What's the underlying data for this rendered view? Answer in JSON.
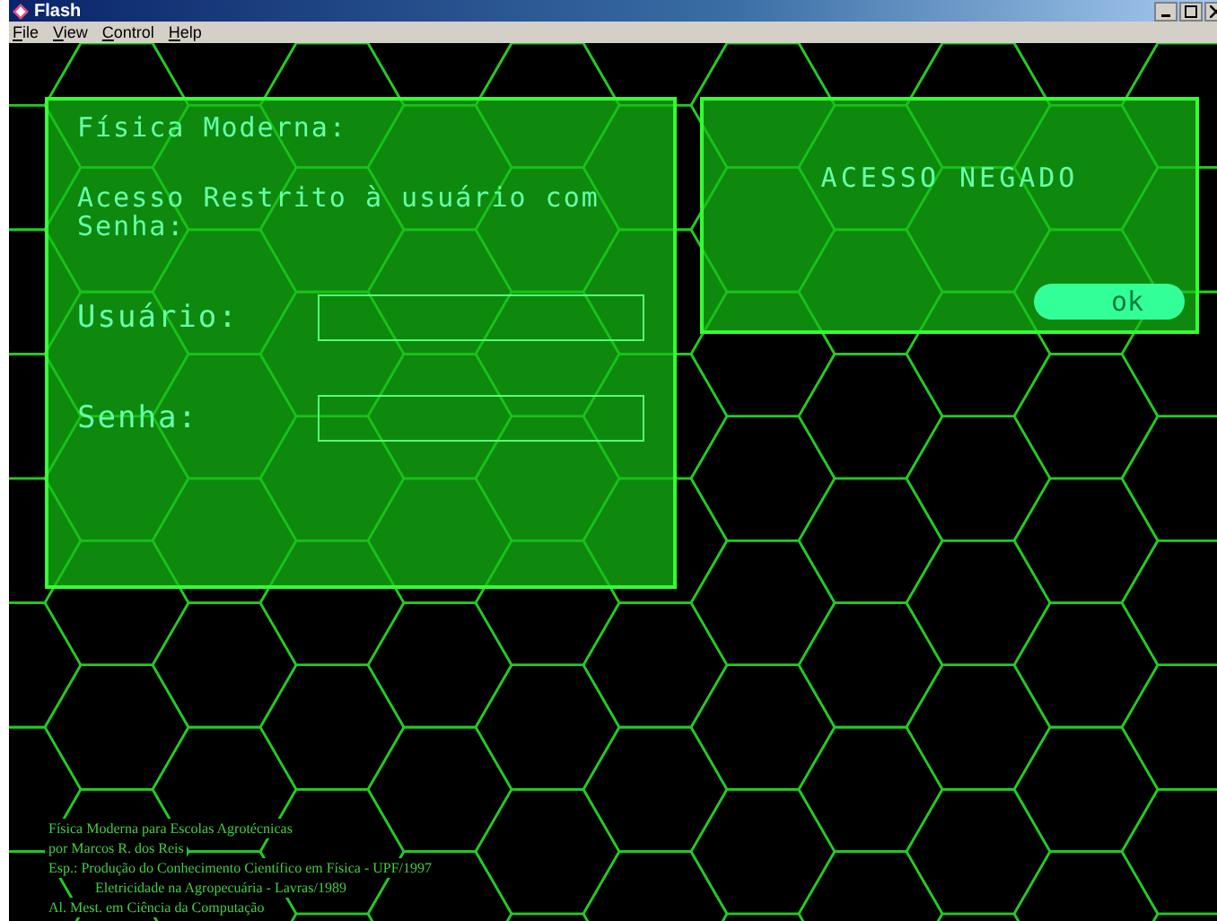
{
  "window": {
    "title": "Flash"
  },
  "menu": [
    "File",
    "View",
    "Control",
    "Help"
  ],
  "login_panel": {
    "title": "Física Moderna:",
    "message": "Acesso Restrito à usuário com Senha:",
    "fields": [
      {
        "label": "Usuário:"
      },
      {
        "label": "Senha:"
      }
    ]
  },
  "alert_panel": {
    "message": "ACESSO NEGADO",
    "button": "ok"
  },
  "credits": [
    "Física Moderna para Escolas Agrotécnicas",
    "por Marcos R. dos Reis",
    "Esp.: Produção do Conhecimento Científico em Física - UPF/1997",
    "Eletricidade na Agropecuária - Lavras/1989",
    "Al. Mest. em Ciência da Computação"
  ]
}
